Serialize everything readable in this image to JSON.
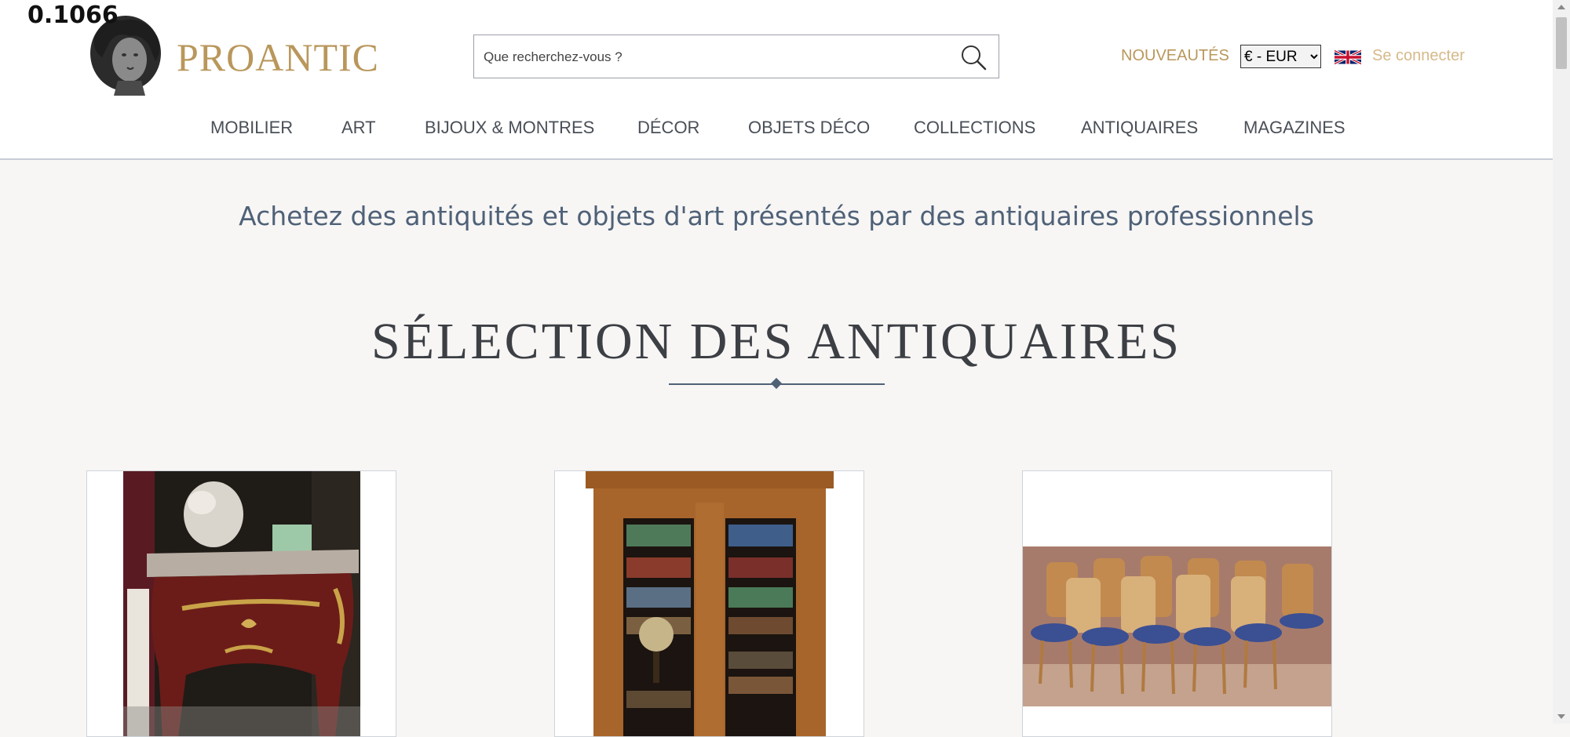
{
  "overlay": {
    "value": "0.1066"
  },
  "header": {
    "logo_text": "PROANTIC",
    "search": {
      "placeholder": "Que recherchez-vous ?"
    },
    "new_link": "NOUVEAUTÉS",
    "currency": {
      "selected": "€ - EUR"
    },
    "login_link": "Se connecter"
  },
  "nav": {
    "items": [
      {
        "label": "MOBILIER"
      },
      {
        "label": "ART"
      },
      {
        "label": "BIJOUX & MONTRES"
      },
      {
        "label": "DÉCOR"
      },
      {
        "label": "OBJETS DÉCO"
      },
      {
        "label": "COLLECTIONS"
      },
      {
        "label": "ANTIQUAIRES"
      },
      {
        "label": "MAGAZINES"
      }
    ]
  },
  "main": {
    "tagline": "Achetez des antiquités et objets d'art présentés par des antiquaires professionnels",
    "section_title": "SÉLECTION DES ANTIQUAIRES"
  },
  "colors": {
    "accent_gold": "#b9975b",
    "text_blue": "#4f6177",
    "background": "#f7f6f5"
  }
}
